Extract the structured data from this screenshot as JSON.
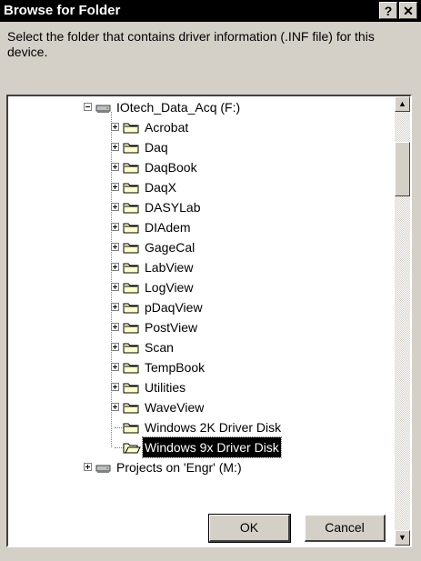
{
  "window": {
    "title": "Browse for Folder",
    "help_label": "?",
    "close_label": "✕"
  },
  "instruction": "Select the folder that contains driver information (.INF file) for this device.",
  "tree": {
    "root": {
      "label": "IOtech_Data_Acq (F:)",
      "icon": "network-drive-icon"
    },
    "folders": [
      {
        "label": "Acrobat",
        "expandable": true
      },
      {
        "label": "Daq",
        "expandable": true
      },
      {
        "label": "DaqBook",
        "expandable": true
      },
      {
        "label": "DaqX",
        "expandable": true
      },
      {
        "label": "DASYLab",
        "expandable": true
      },
      {
        "label": "DIAdem",
        "expandable": true
      },
      {
        "label": "GageCal",
        "expandable": true
      },
      {
        "label": "LabView",
        "expandable": true
      },
      {
        "label": "LogView",
        "expandable": true
      },
      {
        "label": "pDaqView",
        "expandable": true
      },
      {
        "label": "PostView",
        "expandable": true
      },
      {
        "label": "Scan",
        "expandable": true
      },
      {
        "label": "TempBook",
        "expandable": true
      },
      {
        "label": "Utilities",
        "expandable": true
      },
      {
        "label": "WaveView",
        "expandable": true
      },
      {
        "label": "Windows 2K Driver Disk",
        "expandable": false
      },
      {
        "label": "Windows 9x Driver Disk",
        "expandable": false,
        "selected": true
      }
    ],
    "next_drive": {
      "label": "Projects on 'Engr' (M:)",
      "icon": "network-drive-icon"
    }
  },
  "buttons": {
    "ok": "OK",
    "cancel": "Cancel"
  },
  "colors": {
    "face": "#d4d0c8",
    "titlebar": "#000000",
    "selection": "#000000",
    "folder": "#ffffcc"
  }
}
